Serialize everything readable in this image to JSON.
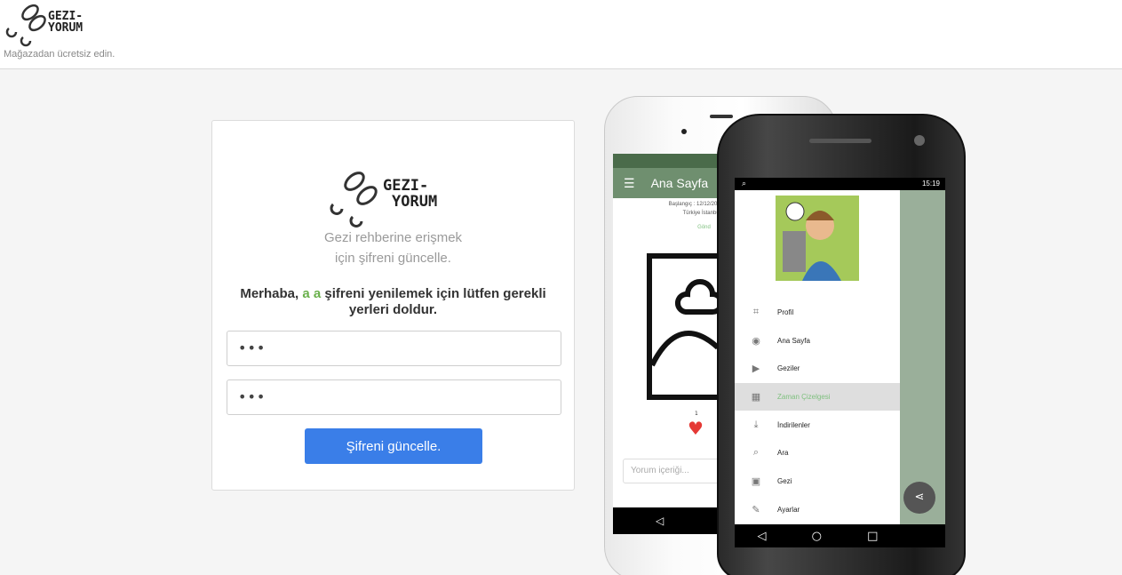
{
  "header": {
    "logo_text_1": "GEZI-",
    "logo_text_2": "YORUM",
    "caption": "Mağazadan ücretsiz edin."
  },
  "card": {
    "logo_text_1": "GEZI-",
    "logo_text_2": "YORUM",
    "subtitle_line1": "Gezi rehberine erişmek",
    "subtitle_line2": "için şifreni güncelle.",
    "greeting_prefix": "Merhaba,",
    "greeting_name": "a a",
    "greeting_suffix": "şifreni yenilemek için lütfen gerekli yerleri doldur.",
    "password1_value": "•••",
    "password2_value": "•••",
    "submit_label": "Şifreni güncelle."
  },
  "iphone": {
    "app_title": "Ana Sayfa",
    "meta_line1": "Başlangıç : 12/12/2017, 21:50",
    "meta_line2": "Türkiye İstanbul A",
    "meta_line3": "Gönd",
    "likes": "1",
    "comment_placeholder": "Yorum içeriği..."
  },
  "android": {
    "time": "15:19",
    "menu": [
      {
        "label": "Profil",
        "icon": "crop-icon"
      },
      {
        "label": "Ana Sayfa",
        "icon": "eye-icon"
      },
      {
        "label": "Geziler",
        "icon": "play-icon"
      },
      {
        "label": "Zaman Çizelgesi",
        "icon": "timeline-icon",
        "active": true
      },
      {
        "label": "İndirilenler",
        "icon": "download-icon"
      },
      {
        "label": "Ara",
        "icon": "search-icon"
      },
      {
        "label": "Gezi",
        "icon": "image-icon"
      },
      {
        "label": "Ayarlar",
        "icon": "wrench-icon"
      }
    ]
  },
  "colors": {
    "accent": "#3a7ee8",
    "highlight": "#6ab04c"
  }
}
